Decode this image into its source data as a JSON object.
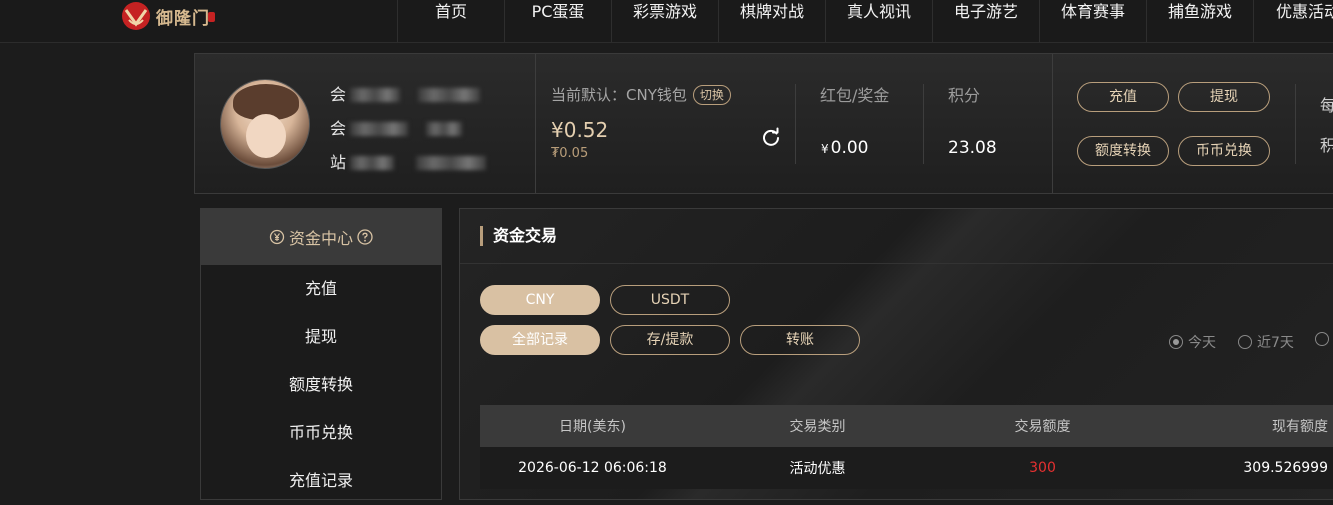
{
  "header": {
    "logo_text": "御隆门",
    "nav": [
      "首页",
      "PC蛋蛋",
      "彩票游戏",
      "棋牌对战",
      "真人视讯",
      "电子游艺",
      "体育赛事",
      "捕鱼游戏",
      "优惠活动"
    ]
  },
  "account": {
    "user_lines": [
      "会",
      "会",
      "站"
    ],
    "wallet_label": "当前默认：CNY钱包",
    "switch_label": "切换",
    "balance": "¥0.52",
    "balance_sub": "₮0.05",
    "bonus_label": "红包/奖金",
    "bonus_currency": "¥",
    "bonus_value": "0.00",
    "points_label": "积分",
    "points_value": "23.08",
    "buttons": [
      "充值",
      "提现",
      "额度转换",
      "币币兑换"
    ],
    "side_hints": [
      "每",
      "积"
    ]
  },
  "sidemenu": {
    "title": "资金中心",
    "items": [
      "充值",
      "提现",
      "额度转换",
      "币币兑换",
      "充值记录"
    ]
  },
  "main": {
    "title": "资金交易",
    "currency_tabs": [
      "CNY",
      "USDT"
    ],
    "record_tabs": [
      "全部记录",
      "存/提款",
      "转账"
    ],
    "date_filters": [
      "今天",
      "近7天"
    ],
    "columns": [
      "日期(美东)",
      "交易类别",
      "交易额度",
      "现有额度"
    ],
    "rows": [
      {
        "date": "2026-06-12 06:06:18",
        "type": "活动优惠",
        "amount": "300",
        "balance": "309.526999"
      }
    ]
  },
  "colors": {
    "accent": "#b89e7c",
    "active_pill": "#d9c1a3",
    "amount": "#e53030"
  }
}
